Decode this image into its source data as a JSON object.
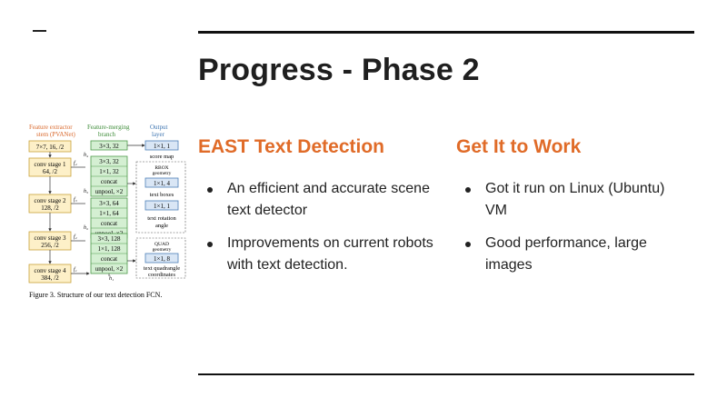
{
  "slide": {
    "title": "Progress - Phase 2"
  },
  "figure": {
    "col_headers": {
      "extractor": [
        "Feature extractor",
        "stem (PVANet)"
      ],
      "merging": [
        "Feature-merging",
        "branch"
      ],
      "output": [
        "Output",
        "layer"
      ]
    },
    "stem_box": "7×7, 16, /2",
    "conv_stages": [
      {
        "line1": "conv stage 1",
        "line2": "64, /2"
      },
      {
        "line1": "conv stage 2",
        "line2": "128, /2"
      },
      {
        "line1": "conv stage 3",
        "line2": "256, /2"
      },
      {
        "line1": "conv stage 4",
        "line2": "384, /2"
      }
    ],
    "merge_top": "3×3, 32",
    "merge_groups": [
      [
        "3×3, 32",
        "1×1, 32",
        "concat",
        "unpool, ×2"
      ],
      [
        "3×3, 64",
        "1×1, 64",
        "concat",
        "unpool, ×2"
      ],
      [
        "3×3, 128",
        "1×1, 128",
        "concat",
        "unpool, ×2"
      ]
    ],
    "f_labels": [
      "f₁",
      "f₂",
      "f₃",
      "f₄"
    ],
    "h_labels": [
      "h₁",
      "h₂",
      "h₃",
      "h₄"
    ],
    "output": {
      "score_box": "1×1, 1",
      "score_label": "score map",
      "rbox_title": [
        "RBOX",
        "geometry"
      ],
      "rbox_boxes": [
        "1×1, 4",
        "1×1, 1"
      ],
      "rbox_labels": [
        "text boxes",
        "text rotation",
        "angle"
      ],
      "quad_title": [
        "QUAD",
        "geometry"
      ],
      "quad_box": "1×1, 8",
      "quad_labels": [
        "text quadrangle",
        "coordinates"
      ]
    },
    "caption": "Figure 3. Structure of our text detection FCN."
  },
  "columns": [
    {
      "heading": "EAST Text Detection",
      "bullets": [
        "An efficient and accurate scene text detector",
        "Improvements on current robots with text detection."
      ]
    },
    {
      "heading": "Get It to Work",
      "bullets": [
        "Got it run on Linux (Ubuntu) VM",
        "Good performance, large images"
      ]
    }
  ],
  "colors": {
    "accent": "#e06b28",
    "yellow_box": "#fdf0c8",
    "yellow_border": "#c9a23a",
    "green_box": "#d4efd2",
    "green_border": "#4e9a4a",
    "blue_box": "#d9e6f5",
    "blue_border": "#4d7fb8",
    "extractor_title": "#d9682b",
    "merging_title": "#3f8d3a",
    "output_title": "#3d74b0"
  }
}
